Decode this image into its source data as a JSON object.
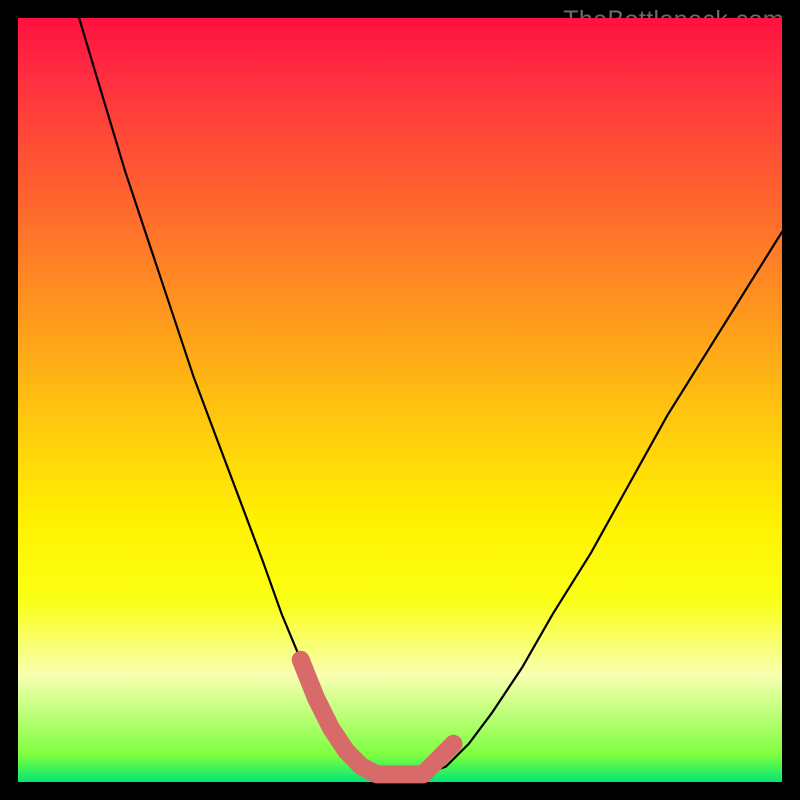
{
  "watermark": "TheBottleneck.com",
  "chart_data": {
    "type": "line",
    "title": "",
    "xlabel": "",
    "ylabel": "",
    "xlim": [
      0,
      100
    ],
    "ylim": [
      0,
      100
    ],
    "series": [
      {
        "name": "bottleneck-curve",
        "x": [
          8,
          11,
          14,
          17,
          20,
          23,
          26,
          29,
          32,
          34.5,
          37,
          39,
          41,
          43,
          45,
          48,
          53,
          56,
          59,
          62,
          66,
          70,
          75,
          80,
          85,
          90,
          95,
          100
        ],
        "y": [
          100,
          90,
          80,
          71,
          62,
          53,
          45,
          37,
          29,
          22,
          16,
          11,
          7,
          4,
          2,
          1,
          1,
          2,
          5,
          9,
          15,
          22,
          30,
          39,
          48,
          56,
          64,
          72
        ]
      }
    ],
    "highlight": {
      "name": "optimal-range",
      "color": "#d96a6a",
      "x": [
        37,
        39,
        41,
        43,
        45,
        47,
        49,
        51,
        53,
        55,
        57
      ],
      "y": [
        16,
        11,
        7,
        4,
        2,
        1,
        1,
        1,
        1,
        3,
        5
      ]
    }
  }
}
